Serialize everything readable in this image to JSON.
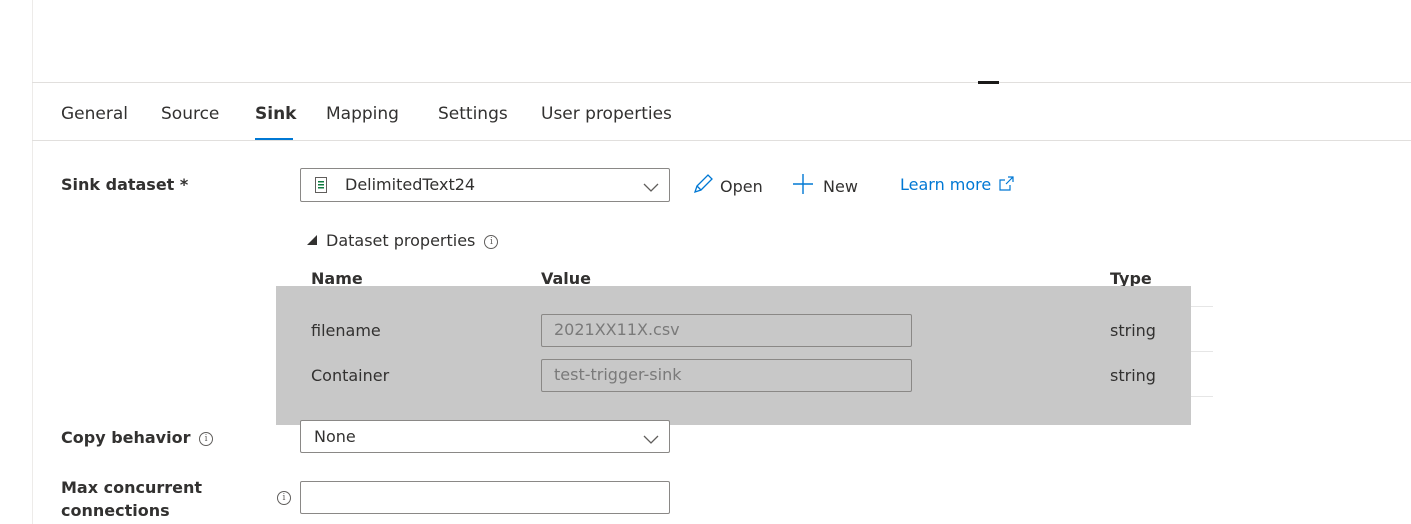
{
  "tabs": [
    {
      "label": "General"
    },
    {
      "label": "Source"
    },
    {
      "label": "Sink"
    },
    {
      "label": "Mapping"
    },
    {
      "label": "Settings"
    },
    {
      "label": "User properties"
    }
  ],
  "active_tab": "Sink",
  "sink_dataset": {
    "label": "Sink dataset *",
    "selected": "DelimitedText24",
    "icon": "delimited-text-file-icon",
    "open_label": "Open",
    "new_label": "New",
    "learn_more_label": "Learn more"
  },
  "dataset_properties": {
    "title": "Dataset properties",
    "headers": {
      "name": "Name",
      "value": "Value",
      "type": "Type"
    },
    "rows": [
      {
        "name": "filename",
        "value": "2021XX11X.csv",
        "type": "string"
      },
      {
        "name": "Container",
        "value": "test-trigger-sink",
        "type": "string"
      }
    ]
  },
  "copy_behavior": {
    "label": "Copy behavior",
    "selected": "None"
  },
  "max_concurrent": {
    "label_line1": "Max concurrent",
    "label_line2": "connections",
    "value": ""
  },
  "colors": {
    "accent": "#0078d4",
    "overlay": "#c8c8c8"
  }
}
